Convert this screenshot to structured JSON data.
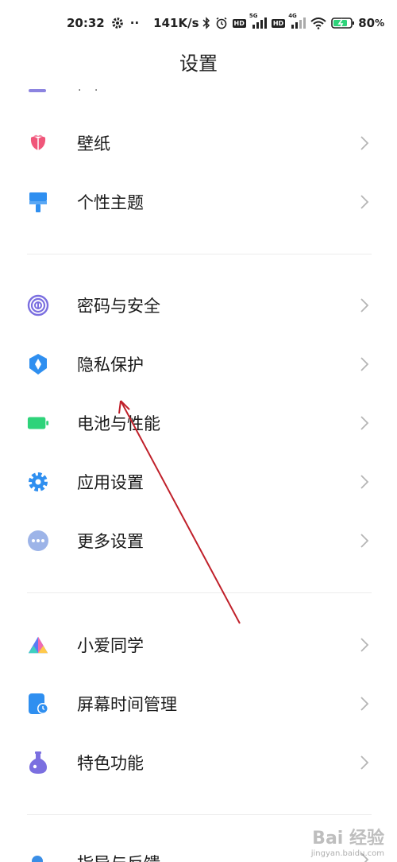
{
  "status_bar": {
    "time": "20:32",
    "dots": "··",
    "net_speed": "141K/s",
    "network_5g": "5G",
    "network_4g": "4G",
    "hd": "HD",
    "battery_percent": "80",
    "percent_sign": "%"
  },
  "page": {
    "title": "设置",
    "top_cut_text": "· · ·"
  },
  "sections": [
    {
      "items": [
        {
          "label": "壁纸",
          "icon": "wallpaper-icon",
          "color": "#f0567a"
        },
        {
          "label": "个性主题",
          "icon": "theme-brush-icon",
          "color": "#2f8ff0"
        }
      ]
    },
    {
      "items": [
        {
          "label": "密码与安全",
          "icon": "fingerprint-icon",
          "color": "#7b6fe0"
        },
        {
          "label": "隐私保护",
          "icon": "privacy-shield-icon",
          "color": "#2f8ff0"
        },
        {
          "label": "电池与性能",
          "icon": "battery-icon",
          "color": "#2ed37a"
        },
        {
          "label": "应用设置",
          "icon": "gear-icon",
          "color": "#2f8ff0"
        },
        {
          "label": "更多设置",
          "icon": "more-dots-icon",
          "color": "#9db4e8"
        }
      ]
    },
    {
      "items": [
        {
          "label": "小爱同学",
          "icon": "xiaoai-icon",
          "color": "#5b7cf5"
        },
        {
          "label": "屏幕时间管理",
          "icon": "screen-time-icon",
          "color": "#2f8ff0"
        },
        {
          "label": "特色功能",
          "icon": "flask-icon",
          "color": "#7b6fe0"
        }
      ]
    }
  ],
  "bottom_partial": {
    "label": "指导与反馈"
  },
  "watermark": {
    "brand": "Bai 经验",
    "url": "jingyan.baidu.com"
  }
}
